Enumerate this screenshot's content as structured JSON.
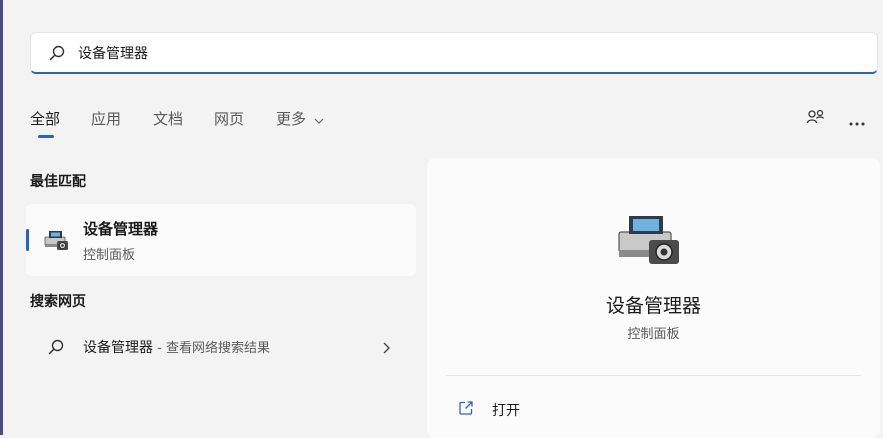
{
  "search": {
    "value": "设备管理器",
    "icon": "search-icon"
  },
  "tabs": [
    {
      "label": "全部",
      "active": true
    },
    {
      "label": "应用"
    },
    {
      "label": "文档"
    },
    {
      "label": "网页"
    },
    {
      "label": "更多",
      "has_dropdown": true
    }
  ],
  "header_icons": [
    "share-profile-icon",
    "more-options-icon"
  ],
  "best_match": {
    "heading": "最佳匹配",
    "title": "设备管理器",
    "subtitle": "控制面板",
    "icon": "device-manager-icon"
  },
  "web_search": {
    "heading": "搜索网页",
    "query": "设备管理器",
    "suffix": " - 查看网络搜索结果",
    "icon": "search-icon"
  },
  "detail": {
    "title": "设备管理器",
    "subtitle": "控制面板",
    "icon": "device-manager-icon",
    "actions": [
      {
        "label": "打开",
        "icon": "open-external-icon"
      }
    ]
  },
  "colors": {
    "accent": "#2b62c6",
    "background": "#f3f3f3",
    "card": "#fbfbfb"
  }
}
